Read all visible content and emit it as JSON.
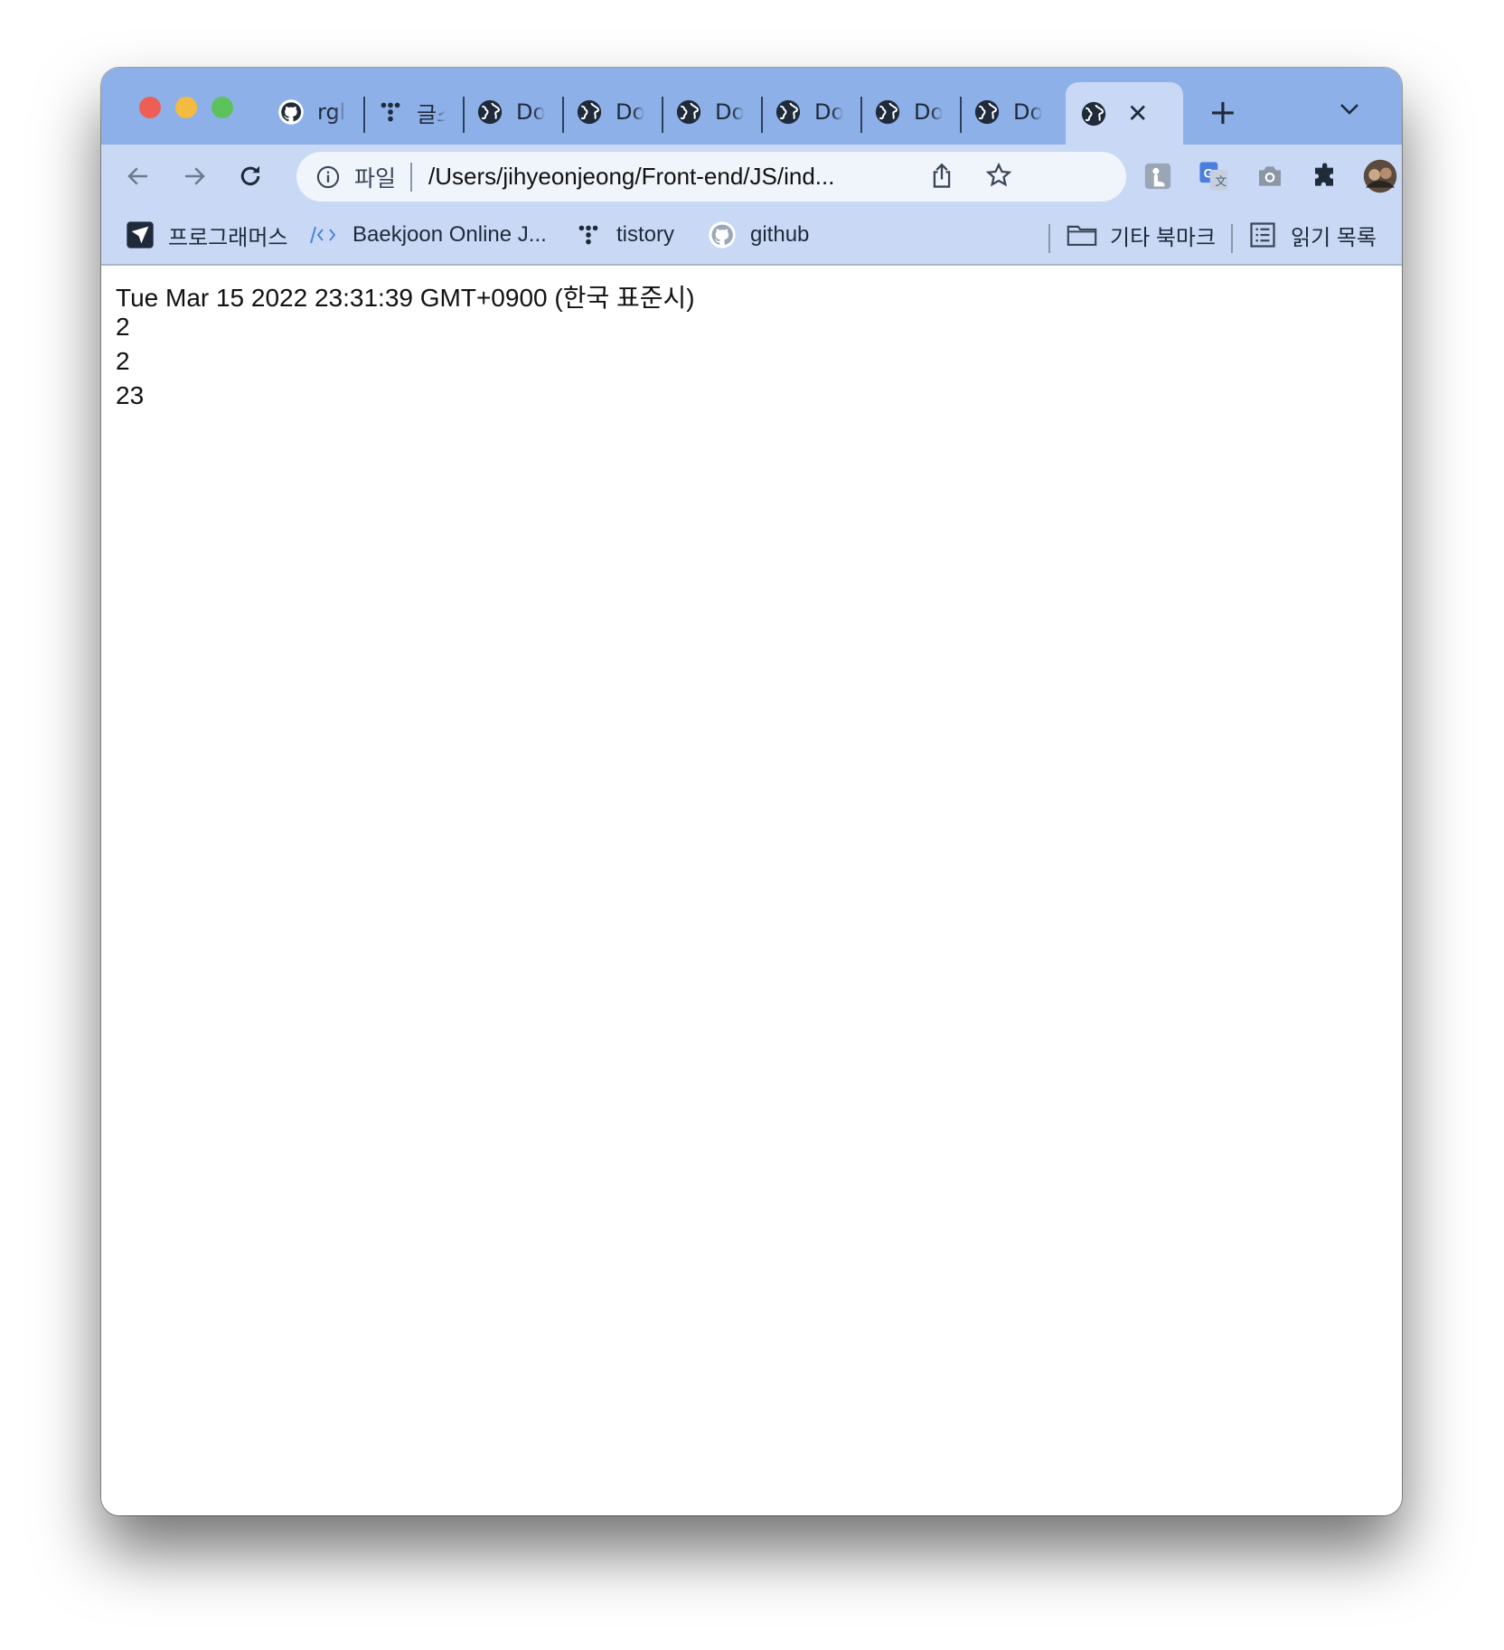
{
  "tabs": [
    {
      "label": "rgl",
      "icon": "github-icon"
    },
    {
      "label": "글스",
      "icon": "tistory-icon"
    },
    {
      "label": "Do",
      "icon": "globe-icon"
    },
    {
      "label": "Do",
      "icon": "globe-icon"
    },
    {
      "label": "Do",
      "icon": "globe-icon"
    },
    {
      "label": "Do",
      "icon": "globe-icon"
    },
    {
      "label": "Do",
      "icon": "globe-icon"
    },
    {
      "label": "Do",
      "icon": "globe-icon"
    }
  ],
  "active_tab": {
    "icon": "globe-icon",
    "close": "✕"
  },
  "new_tab": "+",
  "omnibox": {
    "scheme_label": "파일",
    "url": "/Users/jihyeonjeong/Front-end/JS/ind..."
  },
  "bookmarks": {
    "items": [
      {
        "label": "프로그래머스",
        "icon": "programmers-icon"
      },
      {
        "label": "Baekjoon Online J...",
        "icon": "code-icon"
      },
      {
        "label": "tistory",
        "icon": "tistory-icon"
      },
      {
        "label": "github",
        "icon": "github-icon"
      }
    ],
    "other_bookmarks": "기타 북마크",
    "reading_list": "읽기 목록"
  },
  "page": {
    "lines": [
      "Tue Mar 15 2022 23:31:39 GMT+0900 (한국 표준시)",
      "2",
      "2",
      "23"
    ]
  }
}
